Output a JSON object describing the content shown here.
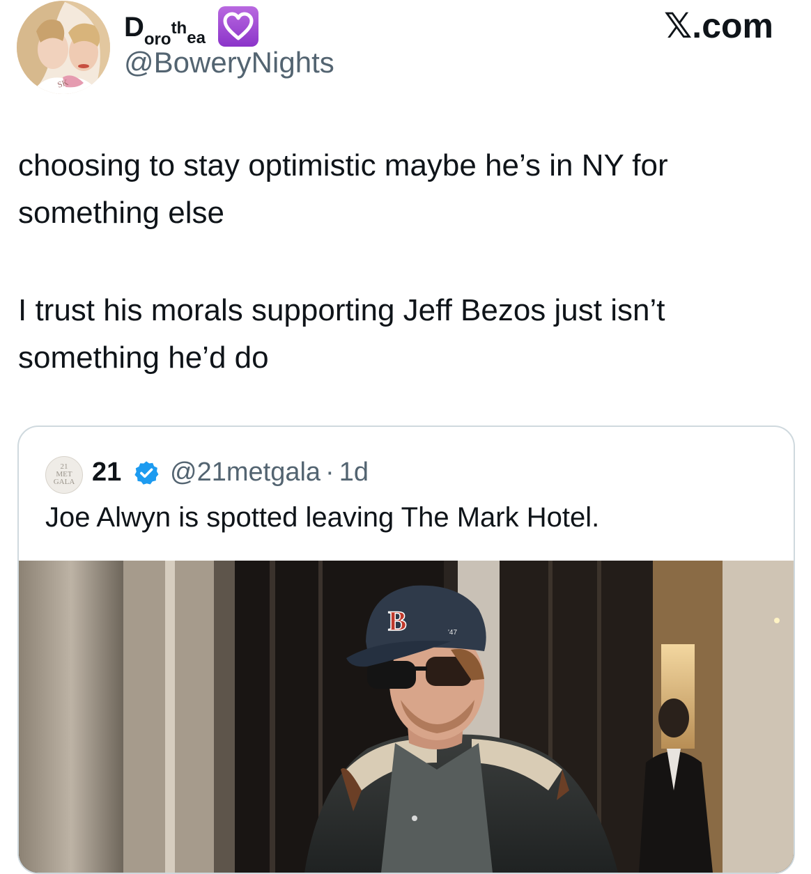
{
  "author": {
    "display_name": {
      "initial": "D",
      "part_oro": "oro",
      "part_th": "th",
      "part_ea": "ea"
    },
    "badge_icon": "purple-heart-icon",
    "handle": "@BoweryNights",
    "avatar_icon": "profile-photo-avatar"
  },
  "site_label": "𝕏.com",
  "tweet": {
    "paragraphs": [
      "choosing to stay optimistic maybe he’s in NY for something else",
      "I trust his morals supporting Jeff Bezos just isn’t something he’d do"
    ]
  },
  "quoted_tweet": {
    "avatar_lines": [
      "21",
      "MET",
      "GALA"
    ],
    "name": "21",
    "verified_icon": "verified-badge-icon",
    "handle": "@21metgala",
    "separator": "·",
    "time": "1d",
    "text": "Joe Alwyn is spotted leaving The Mark Hotel.",
    "photo": {
      "cap_logo": "B",
      "cap_tag": "'47"
    }
  },
  "colors": {
    "text_primary": "#0f1419",
    "text_secondary": "#536471",
    "card_border": "#cfd9de",
    "verified_blue": "#1d9bf0",
    "heart_purple": "#9b46d4"
  }
}
